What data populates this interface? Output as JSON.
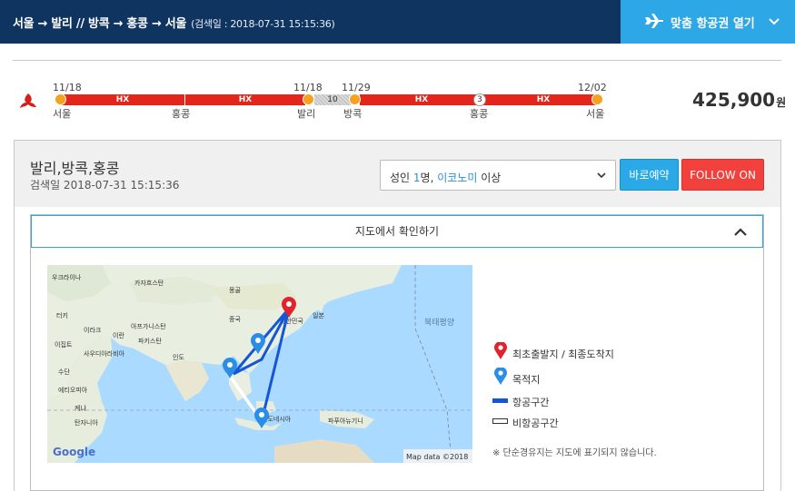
{
  "header": {
    "route": "서울 → 발리 // 방콕 → 홍콩 → 서울",
    "search_date": "(검색일 : 2018-07-31 15:15:36)",
    "open_button": "맞춤 항공권 열기",
    "open_icon": "plane-icon",
    "colors": {
      "bar": "#0f3460",
      "button": "#2da7e6"
    }
  },
  "itinerary": {
    "airline_logo": "hong-kong-airlines-logo",
    "segment_label": "HX",
    "dates": [
      "11/18",
      "11/18",
      "11/29",
      "12/02"
    ],
    "cities": [
      "서울",
      "홍콩",
      "발리",
      "방콕",
      "홍콩",
      "서울"
    ],
    "gap_days": "10",
    "stopover_days": "3",
    "price": "425,900",
    "currency": "원",
    "colors": {
      "segment": "#e3261c",
      "node": "#f4a21f"
    }
  },
  "summary": {
    "destinations": "발리,방콕,홍콩",
    "search_date": "검색일 2018-07-31 15:15:36",
    "passenger_select": {
      "prefix": "성인 ",
      "count": "1",
      "unit": "명, ",
      "cabin": "이코노미",
      "suffix": " 이상"
    },
    "book_button": "바로예약",
    "follow_button": "FOLLOW ON"
  },
  "map": {
    "toggle_title": "지도에서 확인하기",
    "labels": [
      "우크라이나",
      "카자흐스탄",
      "몽골",
      "터키",
      "중국",
      "일본",
      "북태평양",
      "이라크",
      "이란",
      "아프가니스탄",
      "파키스탄",
      "대한민국",
      "이집트",
      "사우디아라비아",
      "인도",
      "수단",
      "에티오피아",
      "케냐",
      "탄자니아",
      "인도네시아",
      "파푸아뉴기니"
    ],
    "google": "Google",
    "attribution": "Map data ©2018"
  },
  "legend": {
    "origin": "최초출발지 / 최종도착지",
    "destination": "목적지",
    "flight": "항공구간",
    "non_flight": "비항공구간",
    "note": "※ 단순경유지는 지도에 표기되지 않습니다.",
    "colors": {
      "origin": "#e0232d",
      "destination": "#2a8ee6",
      "flight": "#1556d6"
    }
  }
}
